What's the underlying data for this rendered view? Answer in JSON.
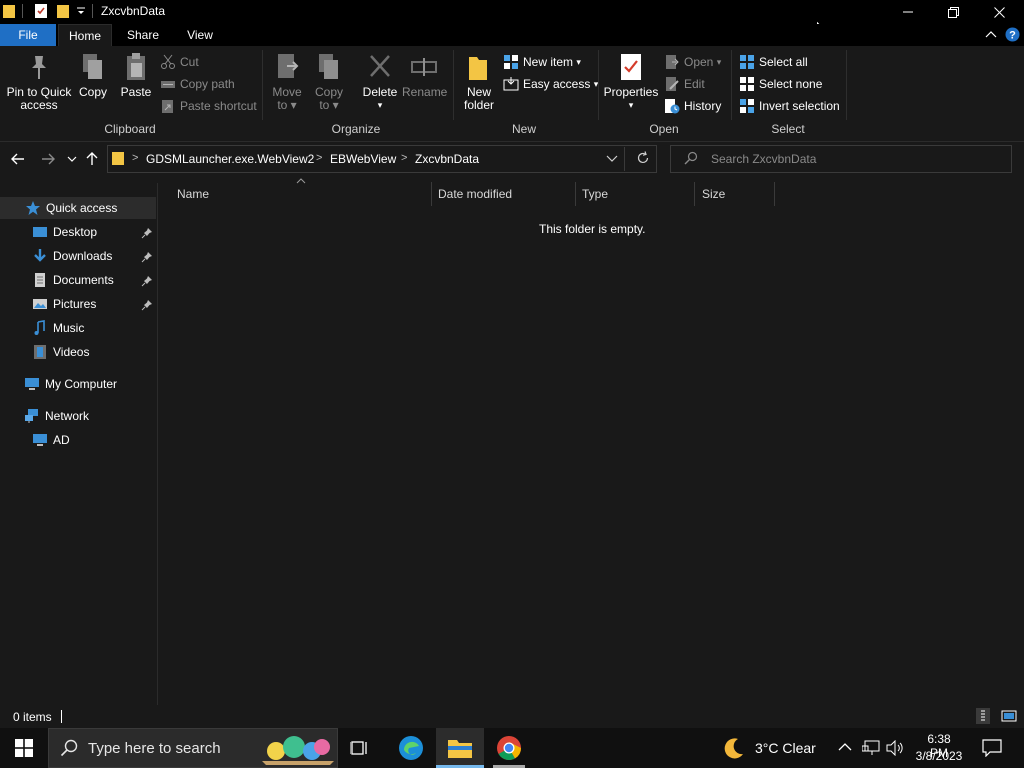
{
  "window": {
    "title": "ZxcvbnData"
  },
  "ribbon_tabs": [
    "File",
    "Home",
    "Share",
    "View"
  ],
  "clipboard": {
    "group_label": "Clipboard",
    "pin_label_1": "Pin to Quick",
    "pin_label_2": "access",
    "copy_label": "Copy",
    "paste_label": "Paste",
    "cut_label": "Cut",
    "copy_path_label": "Copy path",
    "paste_shortcut_label": "Paste shortcut"
  },
  "organize": {
    "group_label": "Organize",
    "move_label_1": "Move",
    "move_label_2": "to",
    "copyto_label_1": "Copy",
    "copyto_label_2": "to",
    "delete_label": "Delete",
    "rename_label": "Rename"
  },
  "new": {
    "group_label": "New",
    "new_folder_label_1": "New",
    "new_folder_label_2": "folder",
    "new_item_label": "New item",
    "easy_access_label": "Easy access"
  },
  "open": {
    "group_label": "Open",
    "properties_label": "Properties",
    "open_label": "Open",
    "edit_label": "Edit",
    "history_label": "History"
  },
  "select": {
    "group_label": "Select",
    "select_all_label": "Select all",
    "select_none_label": "Select none",
    "invert_label": "Invert selection"
  },
  "address": {
    "crumbs": [
      "GDSMLauncher.exe.WebView2",
      "EBWebView",
      "ZxcvbnData"
    ],
    "separator": ">",
    "search_placeholder": "Search ZxcvbnData"
  },
  "nav_pane": {
    "quick_access": "Quick access",
    "items": [
      "Desktop",
      "Downloads",
      "Documents",
      "Pictures",
      "Music",
      "Videos"
    ],
    "my_computer": "My Computer",
    "network": "Network",
    "network_child": "AD"
  },
  "columns": [
    "Name",
    "Date modified",
    "Type",
    "Size"
  ],
  "empty_message": "This folder is empty.",
  "status": {
    "items": "0 items"
  },
  "taskbar": {
    "search_text": "Type here to search",
    "weather": "3°C  Clear",
    "time": "6:38 PM",
    "date": "3/8/2023"
  },
  "colors": {
    "accent": "#1f6fc5",
    "background": "#191919",
    "titlebar": "#000000",
    "taskbar": "#101010",
    "folder_yellow": "#f3c544"
  }
}
